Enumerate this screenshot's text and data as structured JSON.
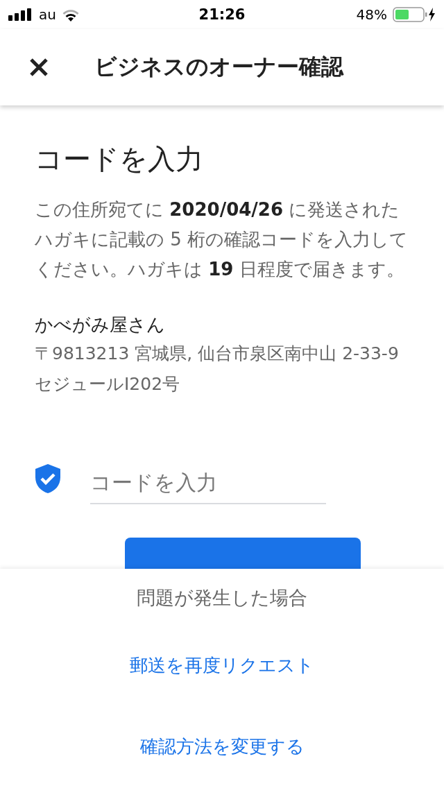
{
  "status_bar": {
    "carrier": "au",
    "time": "21:26",
    "battery": "48%"
  },
  "header": {
    "title": "ビジネスのオーナー確認"
  },
  "heading": "コードを入力",
  "description": "この住所宛てに **2020/04/26** に発送されたハガキに記載の 5 桁の確認コードを入力してください。ハガキは **19** 日程度で届きます。",
  "business": {
    "name": "かべがみ屋さん",
    "address": "〒9813213 宮城県, 仙台市泉区南中山 2-33-9セジュールⅠ202号"
  },
  "code_field": {
    "placeholder": "コードを入力"
  },
  "sheet": {
    "title": "問題が発生した場合",
    "links": [
      "郵送を再度リクエスト",
      "確認方法を変更する"
    ]
  }
}
